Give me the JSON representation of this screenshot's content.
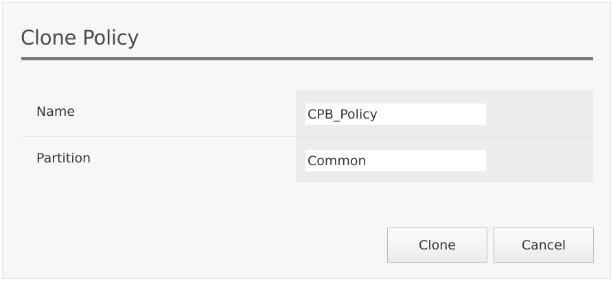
{
  "dialog": {
    "title": "Clone Policy"
  },
  "form": {
    "rows": [
      {
        "label": "Name",
        "value": "CPB_Policy"
      },
      {
        "label": "Partition",
        "value": "Common"
      }
    ]
  },
  "buttons": {
    "clone_label": "Clone",
    "cancel_label": "Cancel"
  }
}
